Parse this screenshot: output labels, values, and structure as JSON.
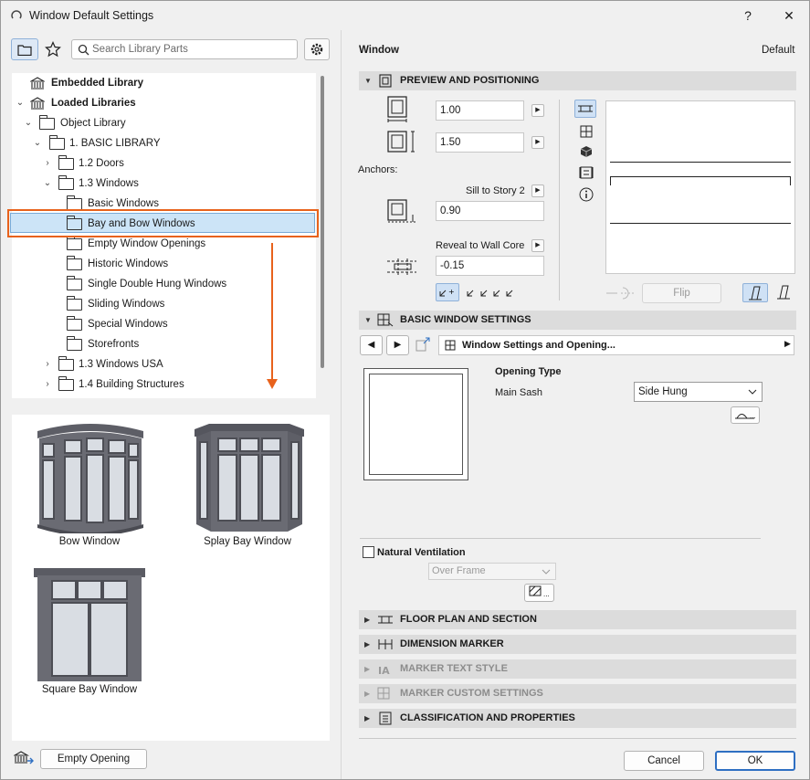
{
  "window": {
    "title": "Window Default Settings",
    "help": "?",
    "close": "✕"
  },
  "library": {
    "search_placeholder": "Search Library Parts",
    "tree": [
      {
        "label": "Embedded Library",
        "bold": true
      },
      {
        "label": "Loaded Libraries",
        "bold": true
      },
      {
        "label": "Object Library"
      },
      {
        "label": "1. BASIC LIBRARY"
      },
      {
        "label": "1.2 Doors"
      },
      {
        "label": "1.3 Windows"
      },
      {
        "label": "Basic Windows"
      },
      {
        "label": "Bay and Bow Windows",
        "selected": true
      },
      {
        "label": "Empty Window Openings"
      },
      {
        "label": "Historic Windows"
      },
      {
        "label": "Single Double Hung Windows"
      },
      {
        "label": "Sliding Windows"
      },
      {
        "label": "Special Windows"
      },
      {
        "label": "Storefronts"
      },
      {
        "label": "1.3 Windows USA"
      },
      {
        "label": "1.4 Building Structures"
      }
    ],
    "thumbnails": [
      {
        "label": "Bow Window"
      },
      {
        "label": "Splay Bay Window"
      },
      {
        "label": "Square Bay Window"
      }
    ],
    "empty_opening_label": "Empty Opening"
  },
  "settings": {
    "header_title": "Window",
    "header_default": "Default",
    "sections": {
      "preview": "PREVIEW AND POSITIONING",
      "basic": "BASIC WINDOW SETTINGS",
      "floor": "FLOOR PLAN AND SECTION",
      "dimension": "DIMENSION MARKER",
      "marker_text": "MARKER TEXT STYLE",
      "marker_custom": "MARKER CUSTOM SETTINGS",
      "classification": "CLASSIFICATION AND PROPERTIES"
    },
    "width_value": "1.00",
    "height_value": "1.50",
    "anchors_label": "Anchors:",
    "sill_label": "Sill to Story 2",
    "sill_value": "0.90",
    "reveal_label": "Reveal to Wall Core",
    "reveal_value": "-0.15",
    "flip_label": "Flip",
    "nav_label": "Window Settings and Opening...",
    "opening_type_label": "Opening Type",
    "main_sash_label": "Main Sash",
    "main_sash_value": "Side Hung",
    "natural_vent_label": "Natural Ventilation",
    "over_frame_value": "Over Frame",
    "cancel_label": "Cancel",
    "ok_label": "OK"
  },
  "colors": {
    "accent_orange": "#e8621c",
    "selection": "#cce4f7",
    "section_bg": "#dcdcdc"
  }
}
